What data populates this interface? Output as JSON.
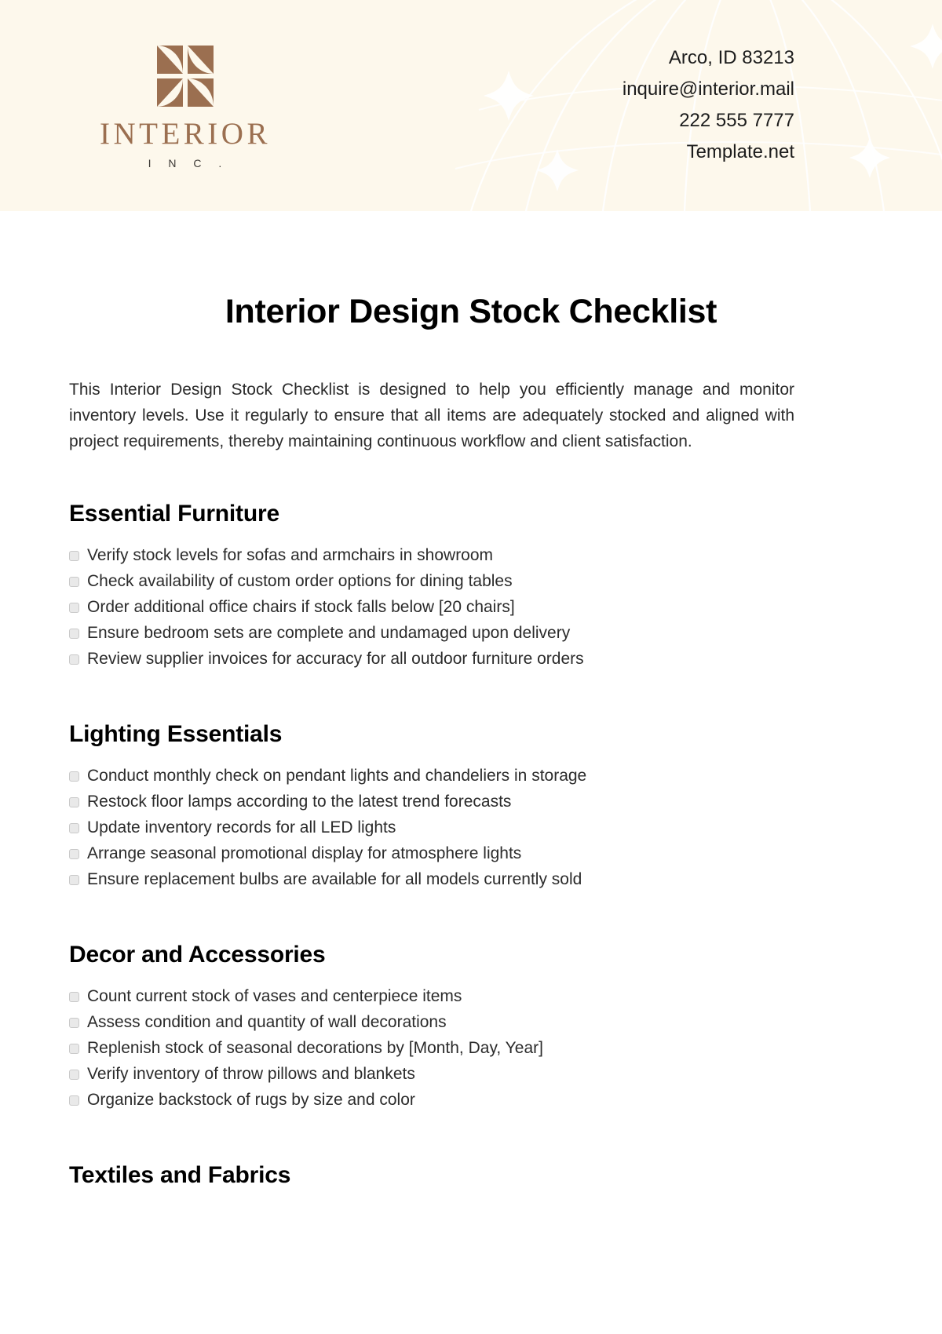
{
  "colors": {
    "header_background": "#fdf8ec",
    "brand_brown": "#9b6f50",
    "page_background": "#ffffff",
    "text": "#2b2b2b",
    "checkbox_fill": "#e9e9e9",
    "checkbox_border": "#c9c9c9"
  },
  "header": {
    "logo": {
      "mark": "four-squares-petal-icon",
      "name": "INTERIOR",
      "suffix": "I N C ."
    },
    "decoration": "globe-meridian-sparkles",
    "contact": [
      "Arco, ID 83213",
      "inquire@interior.mail",
      "222 555 7777",
      "Template.net"
    ]
  },
  "document": {
    "title": "Interior Design Stock Checklist",
    "intro": "This Interior Design Stock Checklist is designed to help you efficiently manage and monitor inventory levels. Use it regularly to ensure that all items are adequately stocked and aligned with project requirements, thereby maintaining continuous workflow and client satisfaction.",
    "sections": [
      {
        "heading": "Essential Furniture",
        "items": [
          "Verify stock levels for sofas and armchairs in showroom",
          "Check availability of custom order options for dining tables",
          "Order additional office chairs if stock falls below [20 chairs]",
          "Ensure bedroom sets are complete and undamaged upon delivery",
          "Review supplier invoices for accuracy for all outdoor furniture orders"
        ]
      },
      {
        "heading": "Lighting Essentials",
        "items": [
          "Conduct monthly check on pendant lights and chandeliers in storage",
          "Restock floor lamps according to the latest trend forecasts",
          "Update inventory records for all LED lights",
          "Arrange seasonal promotional display for atmosphere lights",
          "Ensure replacement bulbs are available for all models currently sold"
        ]
      },
      {
        "heading": "Decor and Accessories",
        "items": [
          "Count current stock of vases and centerpiece items",
          "Assess condition and quantity of wall decorations",
          "Replenish stock of seasonal decorations by [Month, Day, Year]",
          "Verify inventory of throw pillows and blankets",
          "Organize backstock of rugs by size and color"
        ]
      },
      {
        "heading": "Textiles and Fabrics",
        "items": []
      }
    ]
  }
}
